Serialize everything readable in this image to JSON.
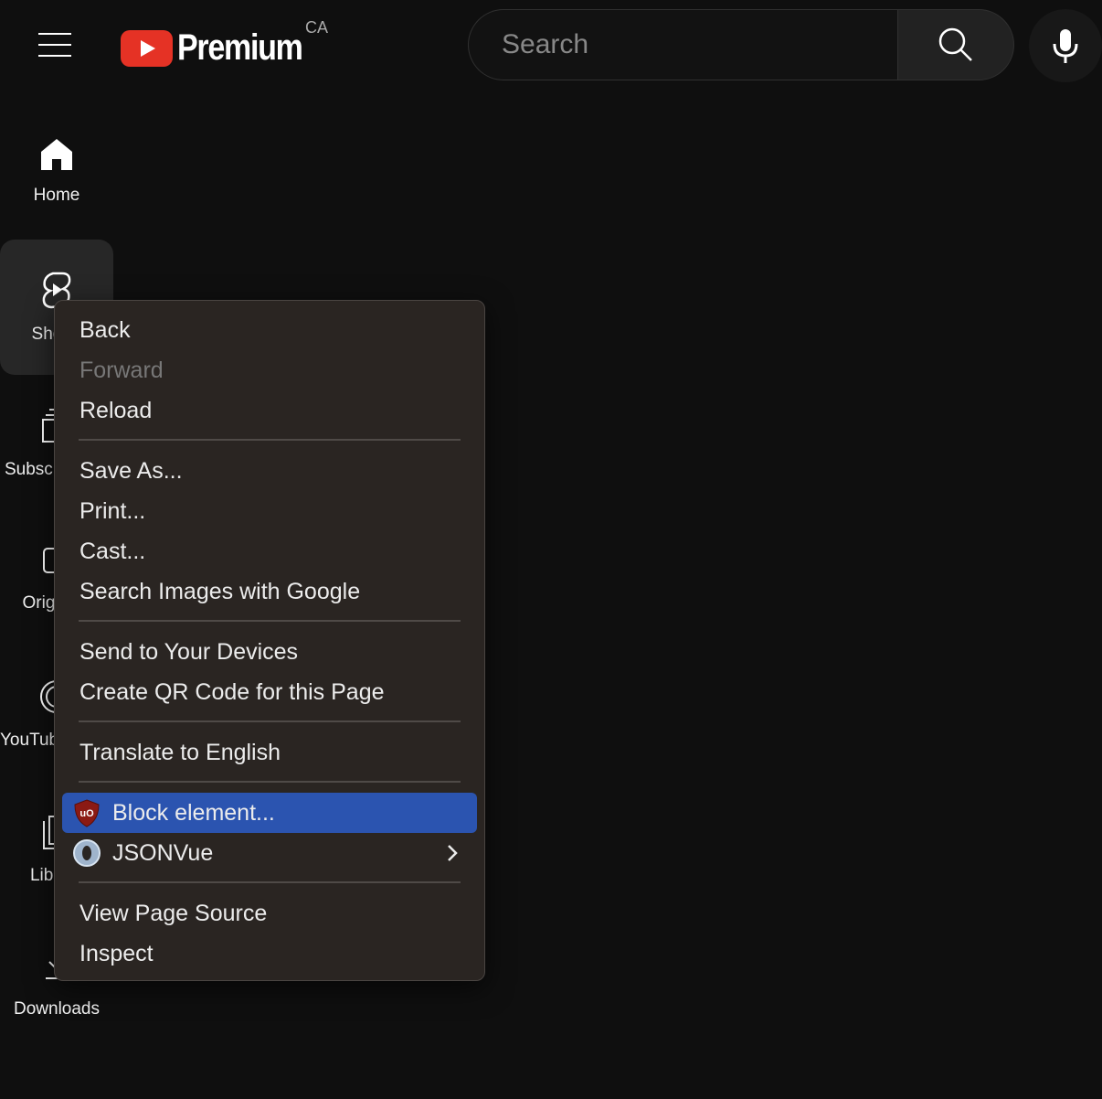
{
  "header": {
    "menu_icon": "hamburger-icon",
    "logo_text": "Premium",
    "region": "CA",
    "search": {
      "placeholder": "Search",
      "value": ""
    },
    "search_icon": "search-icon",
    "mic_icon": "microphone-icon"
  },
  "sidebar": {
    "items": [
      {
        "label": "Home",
        "icon": "home-icon"
      },
      {
        "label": "Shorts",
        "icon": "shorts-icon",
        "active": true
      },
      {
        "label": "Subscriptions",
        "icon": "subscriptions-icon"
      },
      {
        "label": "Originals",
        "icon": "originals-icon"
      },
      {
        "label": "YouTube Music",
        "icon": "youtube-music-icon"
      },
      {
        "label": "Library",
        "icon": "library-icon"
      },
      {
        "label": "Downloads",
        "icon": "download-icon"
      }
    ]
  },
  "context_menu": {
    "items": [
      {
        "label": "Back"
      },
      {
        "label": "Forward",
        "disabled": true
      },
      {
        "label": "Reload"
      },
      {
        "label": "Save As..."
      },
      {
        "label": "Print..."
      },
      {
        "label": "Cast..."
      },
      {
        "label": "Search Images with Google"
      },
      {
        "label": "Send to Your Devices"
      },
      {
        "label": "Create QR Code for this Page"
      },
      {
        "label": "Translate to English"
      },
      {
        "label": "Block element...",
        "icon": "ublock-origin-icon",
        "highlighted": true
      },
      {
        "label": "JSONVue",
        "icon": "jsonvue-icon",
        "submenu": true
      },
      {
        "label": "View Page Source"
      },
      {
        "label": "Inspect"
      }
    ],
    "highlight_color": "#2b54b0"
  }
}
